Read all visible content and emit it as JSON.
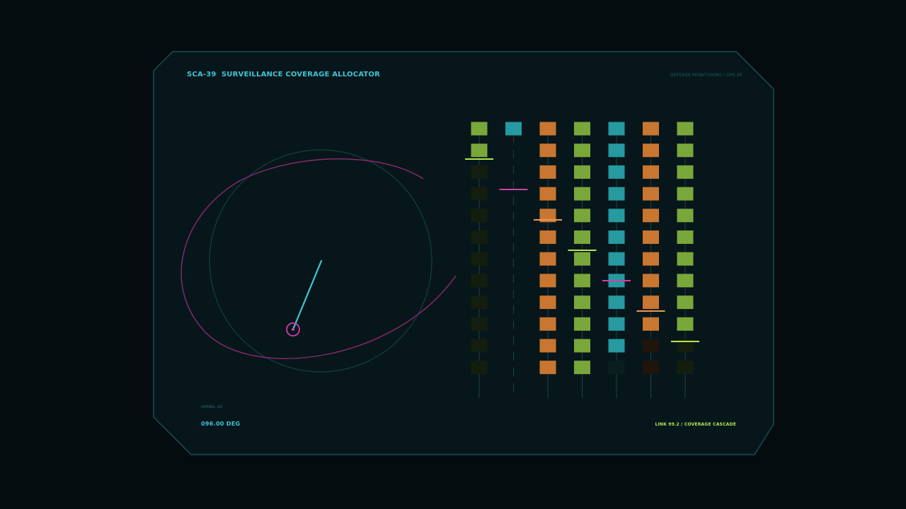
{
  "header": {
    "title": "SCA-39  SURVEILLANCE COVERAGE ALLOCATOR",
    "meta": "DEFENSE MONITORING / OPS 05"
  },
  "gimbal": {
    "label": "GIMBAL AZ",
    "value": "096.00 DEG"
  },
  "status": {
    "text": "LINK 99.2 / COVERAGE CASCADE"
  },
  "colors": {
    "background": "#050c10",
    "panel": "#07161b",
    "panel_border": "#1c5a62",
    "cyan": "#3fc4d6",
    "teal": "#259aa0",
    "green": "#7aa73a",
    "orange": "#c87630",
    "magenta": "#d13ea8",
    "lime": "#b4e84e",
    "peach": "#ee9a52"
  },
  "columns": [
    {
      "color": "green",
      "lit": 2,
      "threshold": "lime"
    },
    {
      "color": "teal",
      "lit": 1,
      "threshold": "magenta"
    },
    {
      "color": "orange",
      "lit": 12,
      "threshold": "peach"
    },
    {
      "color": "green",
      "lit": 12,
      "threshold": "lime"
    },
    {
      "color": "teal",
      "lit": 11,
      "threshold": "magenta"
    },
    {
      "color": "orange",
      "lit": 10,
      "threshold": "peach"
    },
    {
      "color": "green",
      "lit": 10,
      "threshold": "lime"
    }
  ]
}
